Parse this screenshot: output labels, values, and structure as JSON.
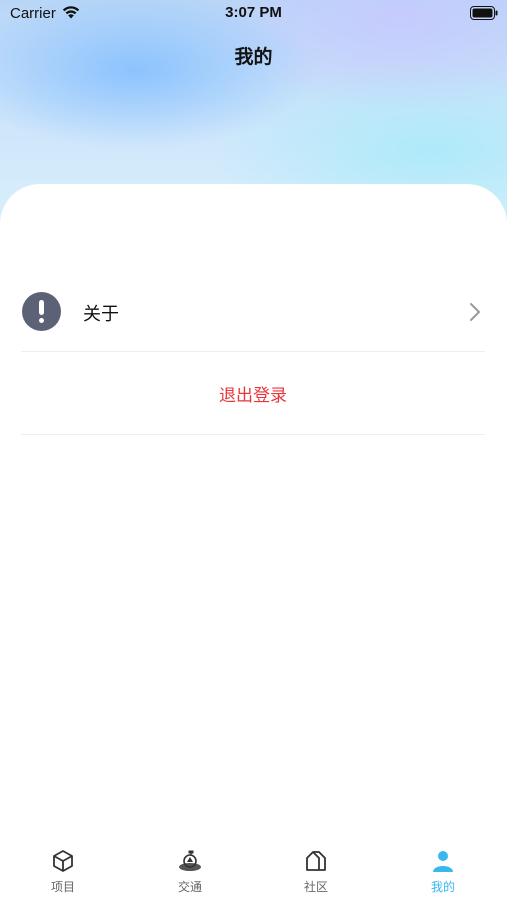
{
  "status_bar": {
    "carrier": "Carrier",
    "time": "3:07 PM",
    "wifi_icon": "wifi-icon",
    "battery_icon": "battery-icon"
  },
  "nav": {
    "title": "我的"
  },
  "menu": {
    "items": [
      {
        "label": "关于",
        "icon": "info-exclamation-icon",
        "trailing_icon": "chevron-right-icon"
      }
    ],
    "logout_label": "退出登录"
  },
  "tabs": [
    {
      "label": "项目",
      "icon": "cube-icon",
      "active": false
    },
    {
      "label": "交通",
      "icon": "traffic-icon",
      "active": false
    },
    {
      "label": "社区",
      "icon": "house-icon",
      "active": false
    },
    {
      "label": "我的",
      "icon": "person-icon",
      "active": true
    }
  ],
  "colors": {
    "accent": "#38b8ee",
    "danger": "#e8363a",
    "icon_dark": "#5d6176",
    "tab_inactive": "#666666"
  }
}
